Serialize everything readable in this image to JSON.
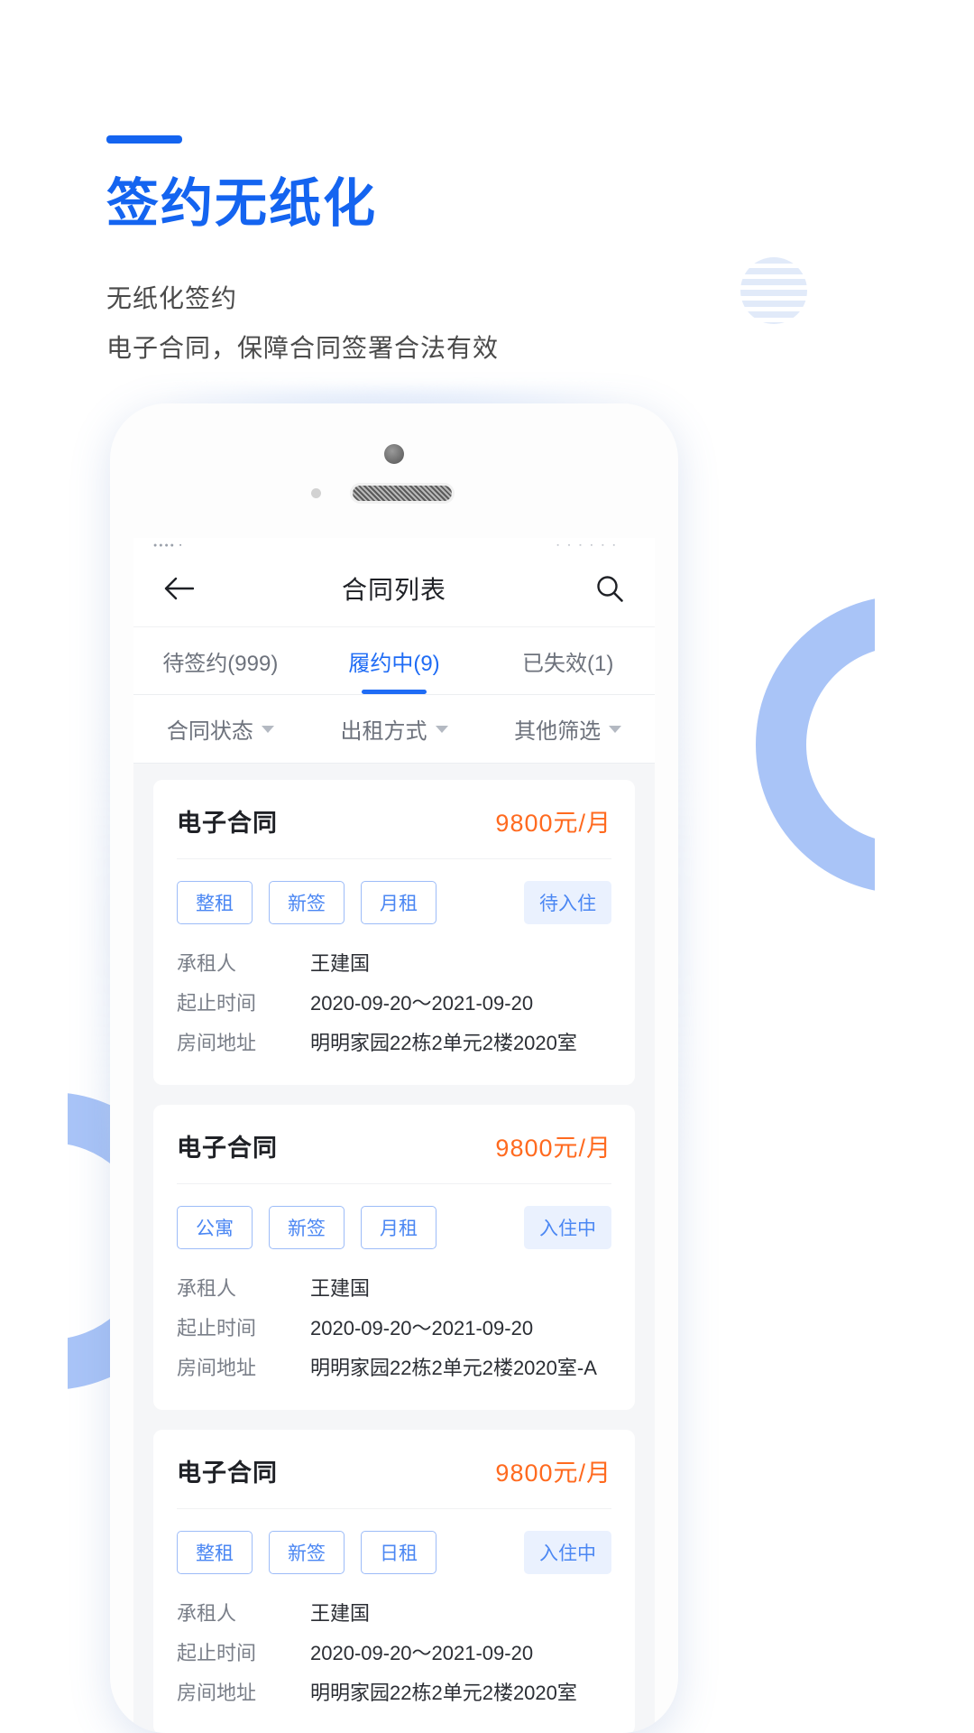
{
  "hero": {
    "title": "签约无纸化",
    "subtitle_line1": "无纸化签约",
    "subtitle_line2": "电子合同，保障合同签署合法有效",
    "accent_color": "#1464f0"
  },
  "phone": {
    "statusbar": {
      "left": "●●●●  ▪",
      "right": "▪ ▪ ▪ ▪ ▪ ▪"
    },
    "navbar": {
      "back_icon": "arrow-left-icon",
      "title": "合同列表",
      "search_icon": "search-icon"
    },
    "tabs": [
      {
        "label": "待签约(999)",
        "active": false
      },
      {
        "label": "履约中(9)",
        "active": true
      },
      {
        "label": "已失效(1)",
        "active": false
      }
    ],
    "filters": [
      {
        "label": "合同状态"
      },
      {
        "label": "出租方式"
      },
      {
        "label": "其他筛选"
      }
    ],
    "labels": {
      "tenant": "承租人",
      "period": "起止时间",
      "address": "房间地址"
    },
    "cards": [
      {
        "type": "电子合同",
        "price": "9800元/月",
        "tags": [
          "整租",
          "新签",
          "月租"
        ],
        "status": "待入住",
        "tenant": "王建国",
        "period": "2020-09-20～2021-09-20",
        "address": "明明家园22栋2单元2楼2020室"
      },
      {
        "type": "电子合同",
        "price": "9800元/月",
        "tags": [
          "公寓",
          "新签",
          "月租"
        ],
        "status": "入住中",
        "tenant": "王建国",
        "period": "2020-09-20～2021-09-20",
        "address": "明明家园22栋2单元2楼2020室-A"
      },
      {
        "type": "电子合同",
        "price": "9800元/月",
        "tags": [
          "整租",
          "新签",
          "日租"
        ],
        "status": "入住中",
        "tenant": "王建国",
        "period": "2020-09-20～2021-09-20",
        "address": "明明家园22栋2单元2楼2020室"
      }
    ]
  }
}
